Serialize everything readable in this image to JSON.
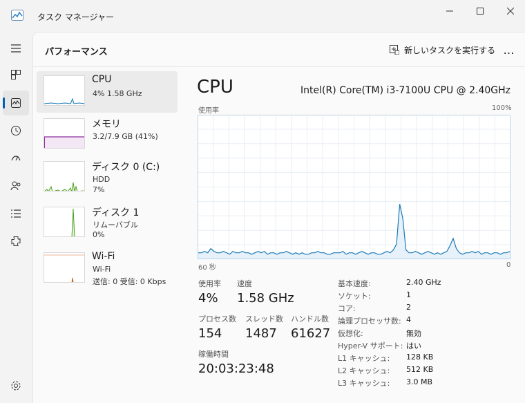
{
  "window": {
    "title": "タスク マネージャー"
  },
  "header": {
    "title": "パフォーマンス",
    "run_task_label": "新しいタスクを実行する",
    "more_label": "…"
  },
  "devices": [
    {
      "name": "CPU",
      "lines": [
        "4%  1.58 GHz"
      ],
      "color": "#1a7ab8"
    },
    {
      "name": "メモリ",
      "lines": [
        "3.2/7.9 GB (41%)"
      ],
      "color": "#8b2c9a"
    },
    {
      "name": "ディスク 0 (C:)",
      "lines": [
        "HDD",
        "7%"
      ],
      "color": "#4ca01e"
    },
    {
      "name": "ディスク 1",
      "lines": [
        "リムーバブル",
        "0%"
      ],
      "color": "#4ca01e"
    },
    {
      "name": "Wi-Fi",
      "lines": [
        "Wi-Fi",
        "送信: 0 受信: 0 Kbps"
      ],
      "color": "#c8641e"
    }
  ],
  "detail": {
    "title": "CPU",
    "model": "Intel(R) Core(TM) i3-7100U CPU @ 2.40GHz",
    "graph_label_top_left": "使用率",
    "graph_label_top_right": "100%",
    "graph_label_bottom_left": "60 秒",
    "graph_label_bottom_right": "0",
    "stats": {
      "usage_label": "使用率",
      "usage_value": "4%",
      "speed_label": "速度",
      "speed_value": "1.58 GHz",
      "processes_label": "プロセス数",
      "processes_value": "154",
      "threads_label": "スレッド数",
      "threads_value": "1487",
      "handles_label": "ハンドル数",
      "handles_value": "61627",
      "uptime_label": "稼働時間",
      "uptime_value": "20:03:23:48"
    },
    "specs": [
      {
        "label": "基本速度:",
        "value": "2.40 GHz"
      },
      {
        "label": "ソケット:",
        "value": "1"
      },
      {
        "label": "コア:",
        "value": "2"
      },
      {
        "label": "論理プロセッサ数:",
        "value": "4"
      },
      {
        "label": "仮想化:",
        "value": "無効"
      },
      {
        "label": "Hyper-V サポート:",
        "value": "はい"
      },
      {
        "label": "L1 キャッシュ:",
        "value": "128 KB"
      },
      {
        "label": "L2 キャッシュ:",
        "value": "512 KB"
      },
      {
        "label": "L3 キャッシュ:",
        "value": "3.0 MB"
      }
    ],
    "usage_series": [
      4,
      4,
      5,
      4,
      7,
      5,
      4,
      4,
      5,
      4,
      3,
      5,
      4,
      4,
      5,
      4,
      4,
      3,
      4,
      5,
      4,
      5,
      3,
      4,
      4,
      3,
      4,
      4,
      5,
      4,
      3,
      4,
      3,
      4,
      3,
      3,
      4,
      4,
      5,
      4,
      4,
      3,
      3,
      4,
      4,
      4,
      5,
      3,
      4,
      4,
      3,
      4,
      5,
      4,
      3,
      4,
      4,
      3,
      3,
      4,
      5,
      4,
      6,
      10,
      38,
      28,
      6,
      4,
      4,
      5,
      4,
      3,
      4,
      5,
      4,
      3,
      4,
      3,
      4,
      5,
      9,
      14,
      7,
      4,
      3,
      4,
      4,
      5,
      4,
      5,
      3,
      4,
      4,
      3,
      4,
      4,
      3,
      4,
      4,
      5
    ]
  }
}
